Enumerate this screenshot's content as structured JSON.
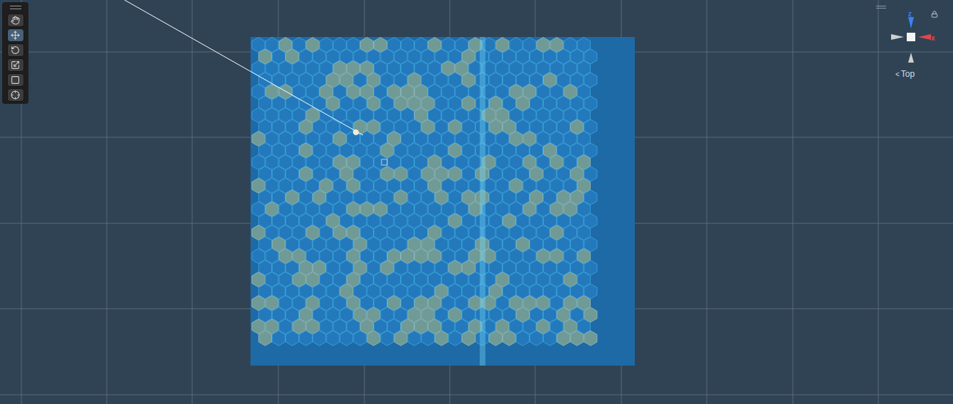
{
  "toolbar": {
    "tools": [
      {
        "name": "hand",
        "selected": false
      },
      {
        "name": "move",
        "selected": true
      },
      {
        "name": "rotate",
        "selected": false
      },
      {
        "name": "scale",
        "selected": false
      },
      {
        "name": "rect",
        "selected": false
      },
      {
        "name": "transform",
        "selected": false
      }
    ]
  },
  "gizmo": {
    "axis_labels": [
      {
        "label": "z",
        "color": "#3b82f6"
      },
      {
        "label": "x",
        "color": "#e0474c"
      }
    ],
    "locked": true
  },
  "view": {
    "icon": "<",
    "label": "Top"
  }
}
